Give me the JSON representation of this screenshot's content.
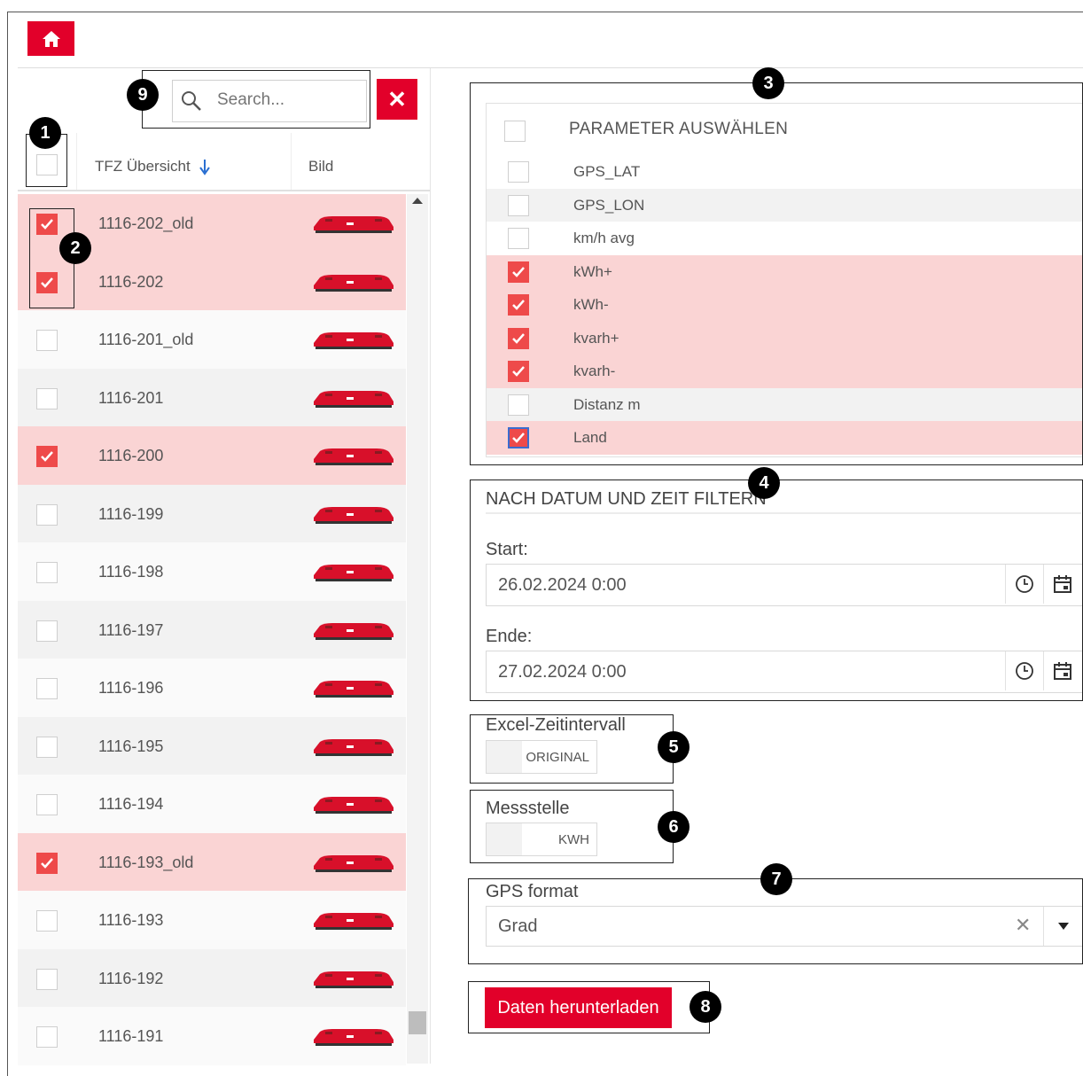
{
  "search": {
    "placeholder": "Search..."
  },
  "left_table": {
    "columns": [
      "TFZ Übersicht",
      "Bild"
    ],
    "rows": [
      {
        "label": "1116-202_old",
        "checked": true
      },
      {
        "label": "1116-202",
        "checked": true
      },
      {
        "label": "1116-201_old",
        "checked": false
      },
      {
        "label": "1116-201",
        "checked": false
      },
      {
        "label": "1116-200",
        "checked": true
      },
      {
        "label": "1116-199",
        "checked": false
      },
      {
        "label": "1116-198",
        "checked": false
      },
      {
        "label": "1116-197",
        "checked": false
      },
      {
        "label": "1116-196",
        "checked": false
      },
      {
        "label": "1116-195",
        "checked": false
      },
      {
        "label": "1116-194",
        "checked": false
      },
      {
        "label": "1116-193_old",
        "checked": true
      },
      {
        "label": "1116-193",
        "checked": false
      },
      {
        "label": "1116-192",
        "checked": false
      },
      {
        "label": "1116-191",
        "checked": false
      }
    ]
  },
  "parameters": {
    "header": "PARAMETER AUSWÄHLEN",
    "items": [
      {
        "label": "GPS_LAT",
        "checked": false
      },
      {
        "label": "GPS_LON",
        "checked": false
      },
      {
        "label": "km/h avg",
        "checked": false
      },
      {
        "label": "kWh+",
        "checked": true
      },
      {
        "label": "kWh-",
        "checked": true
      },
      {
        "label": "kvarh+",
        "checked": true
      },
      {
        "label": "kvarh-",
        "checked": true
      },
      {
        "label": "Distanz m",
        "checked": false
      },
      {
        "label": "Land",
        "checked": true
      }
    ]
  },
  "date_filter": {
    "title": "NACH DATUM UND ZEIT FILTERN",
    "start_label": "Start:",
    "start_value": "26.02.2024 0:00",
    "end_label": "Ende:",
    "end_value": "27.02.2024 0:00"
  },
  "excel": {
    "label": "Excel-Zeitintervall",
    "value": "ORIGINAL"
  },
  "messstelle": {
    "label": "Messstelle",
    "value": "KWH"
  },
  "gps": {
    "label": "GPS format",
    "value": "Grad"
  },
  "download": {
    "label": "Daten herunterladen"
  },
  "badges": [
    "1",
    "2",
    "3",
    "4",
    "5",
    "6",
    "7",
    "8",
    "9"
  ],
  "colors": {
    "accent": "#e2002a",
    "selected_row": "#fad4d4",
    "checkbox_on": "#ee4a4a"
  }
}
